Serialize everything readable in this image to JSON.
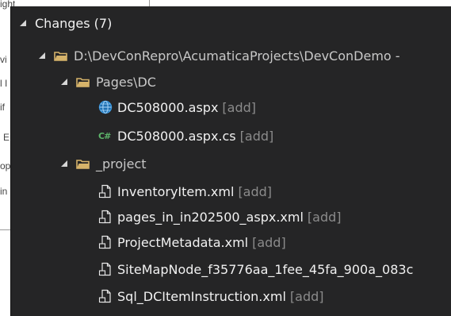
{
  "background_window": {
    "fragments": [
      "ight",
      "vi",
      "l I",
      "if",
      "E",
      "op",
      "in"
    ]
  },
  "changes": {
    "header_label": "Changes (7)",
    "project_path": "D:\\DevConRepro\\AcumaticaProjects\\DevConDemo -",
    "folders": [
      {
        "name": "Pages\\DC",
        "files": [
          {
            "name": "DC508000.aspx",
            "status": "[add]",
            "icon": "globe-icon"
          },
          {
            "name": "DC508000.aspx.cs",
            "status": "[add]",
            "icon": "csharp-icon"
          }
        ]
      },
      {
        "name": "_project",
        "files": [
          {
            "name": "InventoryItem.xml",
            "status": "[add]",
            "icon": "xml-file-icon"
          },
          {
            "name": "pages_in_in202500_aspx.xml",
            "status": "[add]",
            "icon": "xml-file-icon"
          },
          {
            "name": "ProjectMetadata.xml",
            "status": "[add]",
            "icon": "xml-file-icon"
          },
          {
            "name": "SiteMapNode_f35776aa_1fee_45fa_900a_083c",
            "status": "",
            "icon": "xml-file-icon"
          },
          {
            "name": "Sql_DCItemInstruction.xml",
            "status": "[add]",
            "icon": "xml-file-icon"
          }
        ]
      }
    ]
  },
  "colors": {
    "panel_bg": "#252526",
    "folder": "#d6b36a",
    "globe": "#3a96dd",
    "csharp": "#5db56a",
    "status_tag": "#8b8b8b"
  }
}
